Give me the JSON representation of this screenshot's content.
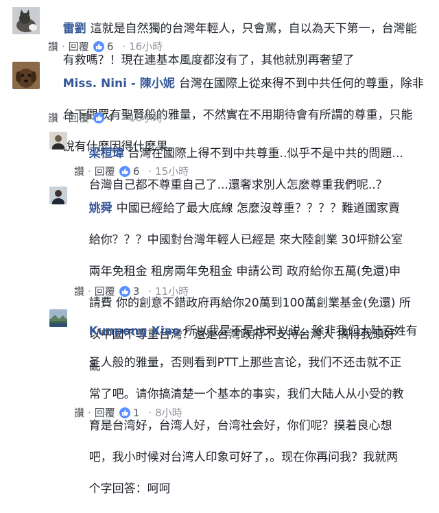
{
  "comments": [
    {
      "author": "雷劉",
      "lines": [
        "這就是自然獨的台灣年輕人，只會罵，自以為天下第一，台灣能",
        "有救嗎？！現在連基本風度都沒有了，其他就別再奢望了"
      ],
      "like_label": "讚",
      "reply_label": "回覆",
      "likes": "6",
      "time": "16小時",
      "avatar_icon": "cat-avatar-icon"
    },
    {
      "author": "Miss. Nini - 陳小妮",
      "lines": [
        "台灣在國際上從來得不到中共任何的尊重，除非",
        "台下觀眾有聖賢般的雅量，不然實在不用期待會有所謂的尊重，只能",
        "說有什麼因得什麼果。"
      ],
      "like_label": "讚",
      "reply_label": "回覆",
      "likes": "4",
      "time": "16小時",
      "avatar_icon": "dog-avatar-icon"
    },
    {
      "author": "梁桓瑋",
      "lines": [
        "台灣在國際上得不到中共尊重..似乎不是中共的問題...",
        "台灣自己都不尊重自己了...還奢求別人怎麼尊重我們呢..？"
      ],
      "like_label": "讚",
      "reply_label": "回覆",
      "likes": "6",
      "time": "15小時",
      "avatar_icon": "person-avatar-icon"
    },
    {
      "author": "姚舜",
      "lines": [
        "中國已經給了最大底線 怎麼沒尊重？？？？難道國家賣",
        "給你？？？中國對台灣年輕人已經是 來大陸創業 30坪辦公室",
        "兩年免租金 租房兩年免租金 申請公司 政府給你五萬(免還)申",
        "請費 你的創意不錯政府再給你20萬到100萬創業基金(免還) 所",
        "以中國不尊重台灣？還是台灣政府不支持台灣人 搞得我頭好",
        "亂"
      ],
      "like_label": "讚",
      "reply_label": "回覆",
      "likes": "3",
      "time": "11小時",
      "avatar_icon": "person-avatar-icon"
    },
    {
      "author": "Kunpeng Xiao",
      "lines": [
        "所以我是不是也可以说，除非我们大陆百姓有",
        "圣人般的雅量，否则看到PTT上那些言论，我们不还击就不正",
        "常了吧。请你搞清楚一个基本的事实，我们大陆人从小受的教",
        "育是台湾好，台湾人好，台湾社会好，你们呢？摸着良心想",
        "吧，我小时候对台湾人印象可好了，。现在你再问我？我就两",
        "个字回答：呵呵"
      ],
      "like_label": "讚",
      "reply_label": "回覆",
      "likes": "1",
      "time": "8小時",
      "avatar_icon": "landscape-avatar-icon"
    }
  ]
}
